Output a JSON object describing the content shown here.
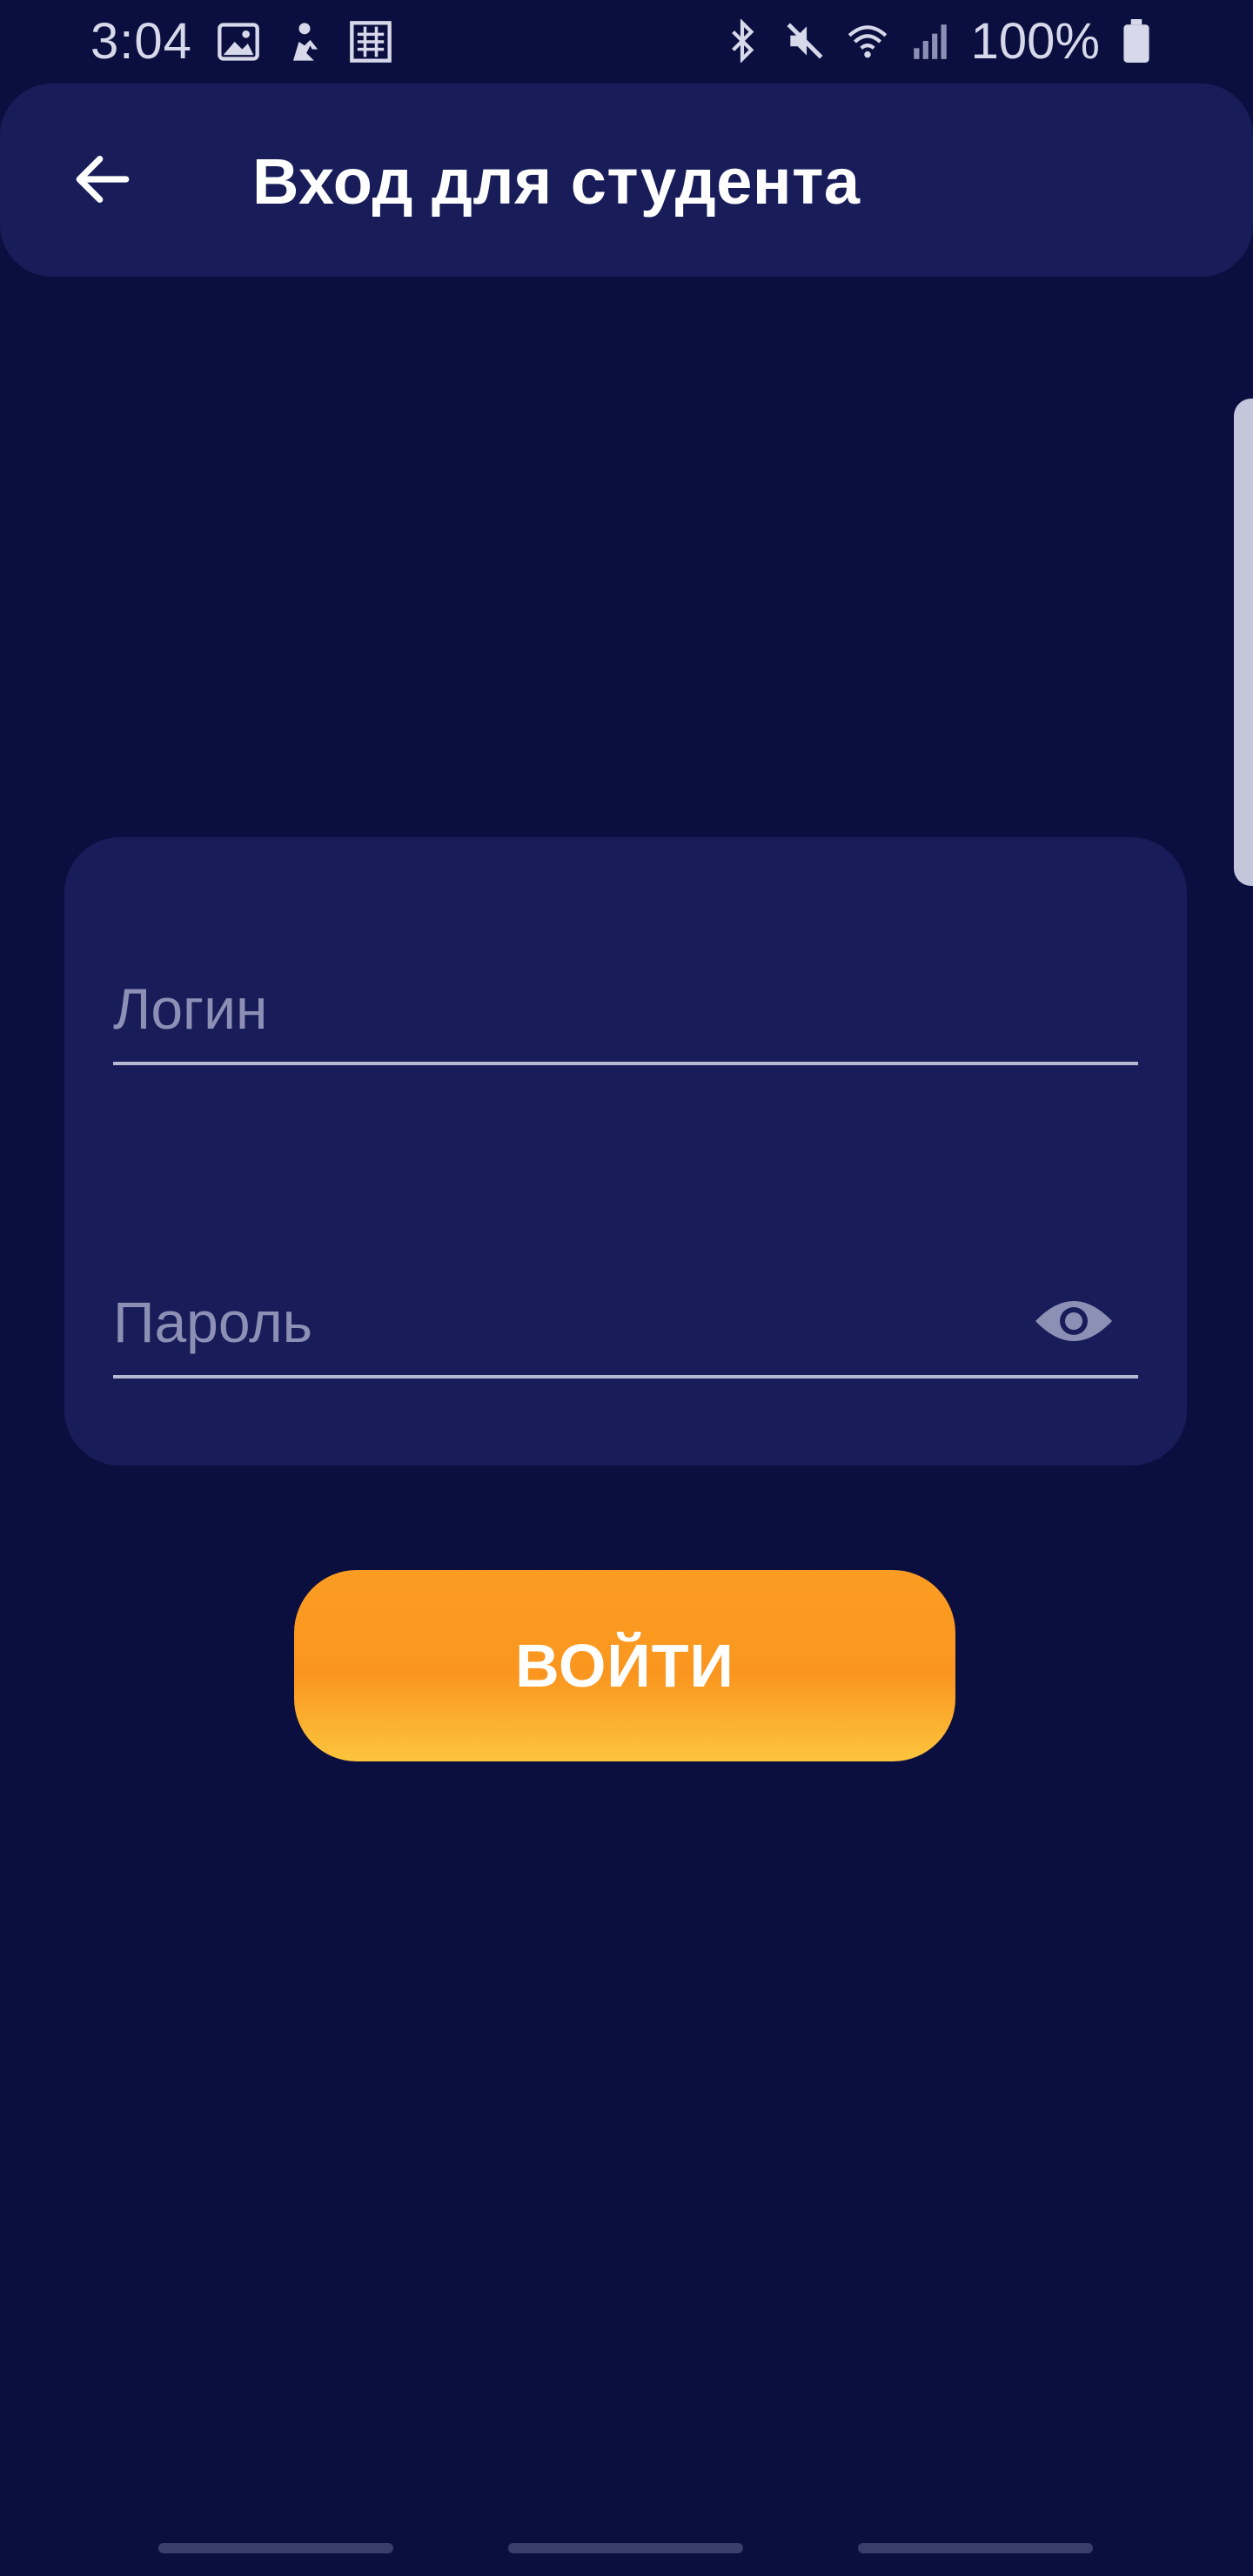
{
  "status_bar": {
    "time": "3:04",
    "battery_percent": "100%",
    "left_icons": [
      "gallery-icon",
      "fitness-icon",
      "app-notification-icon"
    ],
    "right_icons": [
      "bluetooth-icon",
      "mute-icon",
      "wifi-icon",
      "signal-icon",
      "battery-icon"
    ]
  },
  "app_bar": {
    "title": "Вход для студента",
    "back_icon": "arrow-left-icon"
  },
  "form": {
    "login": {
      "placeholder": "Логин",
      "value": ""
    },
    "password": {
      "placeholder": "Пароль",
      "value": "",
      "toggle_icon": "eye-icon"
    }
  },
  "login_button": {
    "label": "ВОЙТИ"
  },
  "colors": {
    "background": "#0b0f3f",
    "surface": "#181d5a",
    "accent_top": "#fb9d22",
    "accent_bottom": "#fcc53d",
    "placeholder": "#8d90b5"
  }
}
